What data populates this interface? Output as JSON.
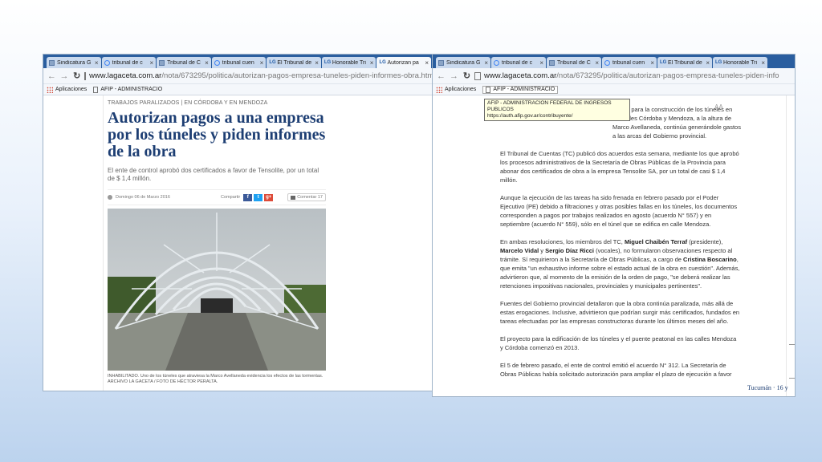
{
  "left": {
    "tabs": [
      {
        "title": "Sindicatura G",
        "icon": "doc"
      },
      {
        "title": "tribunal de c",
        "icon": "g"
      },
      {
        "title": "Tribunal de C",
        "icon": "doc"
      },
      {
        "title": "tribunal cuen",
        "icon": "g"
      },
      {
        "title": "El Tribunal de",
        "icon": "lg"
      },
      {
        "title": "Honorable Tri",
        "icon": "lg"
      },
      {
        "title": "Autorizan pa",
        "icon": "lg",
        "active": true
      }
    ],
    "url_host": "www.lagaceta.com.ar",
    "url_path": "/nota/673295/politica/autorizan-pagos-empresa-tuneles-piden-informes-obra.html",
    "bookmarks": {
      "apps": "Aplicaciones",
      "afip": "AFIP - ADMINISTRACIO"
    },
    "article": {
      "kicker": "TRABAJOS PARALIZADOS | EN CÓRDOBA Y EN MENDOZA",
      "headline": "Autorizan pagos a una empresa por los túneles y piden informes de la obra",
      "subtitle": "El ente de control aprobó dos certificados a favor de Tensolite, por un total de $ 1,4 millón.",
      "date": "Domingo 06 de Marzo 2016",
      "share_label": "Compartir",
      "social": {
        "fb": "f",
        "tw": "t",
        "gp": "g+"
      },
      "comment_label": "Comentar",
      "comment_count": "17",
      "caption": "INHABILITADO. Uno de los túneles que atraviesa la Marco Avellaneda evidencia los efectos de las tormentas. ARCHIVO LA GACETA / FOTO DE HÉCTOR PERALTA."
    }
  },
  "right": {
    "tabs": [
      {
        "title": "Sindicatura G",
        "icon": "doc"
      },
      {
        "title": "tribunal de c",
        "icon": "g"
      },
      {
        "title": "Tribunal de C",
        "icon": "doc"
      },
      {
        "title": "tribunal cuen",
        "icon": "g"
      },
      {
        "title": "El Tribunal de",
        "icon": "lg"
      },
      {
        "title": "Honorable Tri",
        "icon": "lg"
      }
    ],
    "url_host": "www.lagaceta.com.ar",
    "url_path": "/nota/673295/politica/autorizan-pagos-empresa-tuneles-piden-info",
    "bookmarks": {
      "apps": "Aplicaciones",
      "afip": "AFIP - ADMINISTRACIO"
    },
    "tooltip": {
      "line1": "AFIP - ADMINISTRACION FEDERAL DE INGRESOS PUBLICOS",
      "line2": "https://auth.afip.gov.ar/contribuyente/"
    },
    "font_size_label": "AA",
    "paragraphs": {
      "p1": "a obra para la construcción de los túneles en las calles Córdoba y Mendoza, a la altura de Marco Avellaneda, continúa generándole gastos a las arcas del Gobierno provincial.",
      "p2": "El Tribunal de Cuentas (TC) publicó dos acuerdos esta semana, mediante los que aprobó los procesos administrativos de la Secretaría de Obras Públicas de la Provincia para abonar dos certificados de obra a la empresa Tensolite SA, por un total de casi $ 1,4 millón.",
      "p3": "Aunque la ejecución de las tareas ha sido frenada en febrero pasado por el Poder Ejecutivo (PE) debido a filtraciones y otras posibles fallas en los túneles, los documentos corresponden a pagos por trabajos realizados en agosto (acuerdo N° 557) y en septiembre (acuerdo N° 559), sólo en el túnel que se edifica en calle Mendoza.",
      "p4_a": "En ambas resoluciones, los miembros del TC, ",
      "p4_b": "Miguel Chaibén Terraf",
      "p4_c": " (presidente), ",
      "p4_d": "Marcelo Vidal",
      "p4_e": " y ",
      "p4_f": "Sergio Díaz Ricci",
      "p4_g": " (vocales), no formularon observaciones respecto al trámite. Sí requirieron a la Secretaría de Obras Públicas, a cargo de ",
      "p4_h": "Cristina Boscarino",
      "p4_i": ", que emita \"un exhaustivo informe sobre el estado actual de la obra en cuestión\". Además, advirtieron que, al momento de la emisión de la orden de pago, \"se deberá realizar las retenciones impositivas nacionales, provinciales y municipales pertinentes\".",
      "p5": "Fuentes del Gobierno provincial detallaron que la obra continúa paralizada, más allá de estas erogaciones. Inclusive, advirtieron que podrían surgir más certificados, fundados en tareas efectuadas por las empresas constructoras durante los últimos meses del año.",
      "p6": "El proyecto para la edificación de los túneles y el puente peatonal en las calles Mendoza y Córdoba comenzó en 2013.",
      "p7": "El 5 de febrero pasado, el ente de control emitió el acuerdo N° 312. La Secretaría de Obras Públicas había solicitado autorización para ampliar el plazo de ejecución a favor"
    },
    "side_text": "Tucumán · 16 y"
  }
}
